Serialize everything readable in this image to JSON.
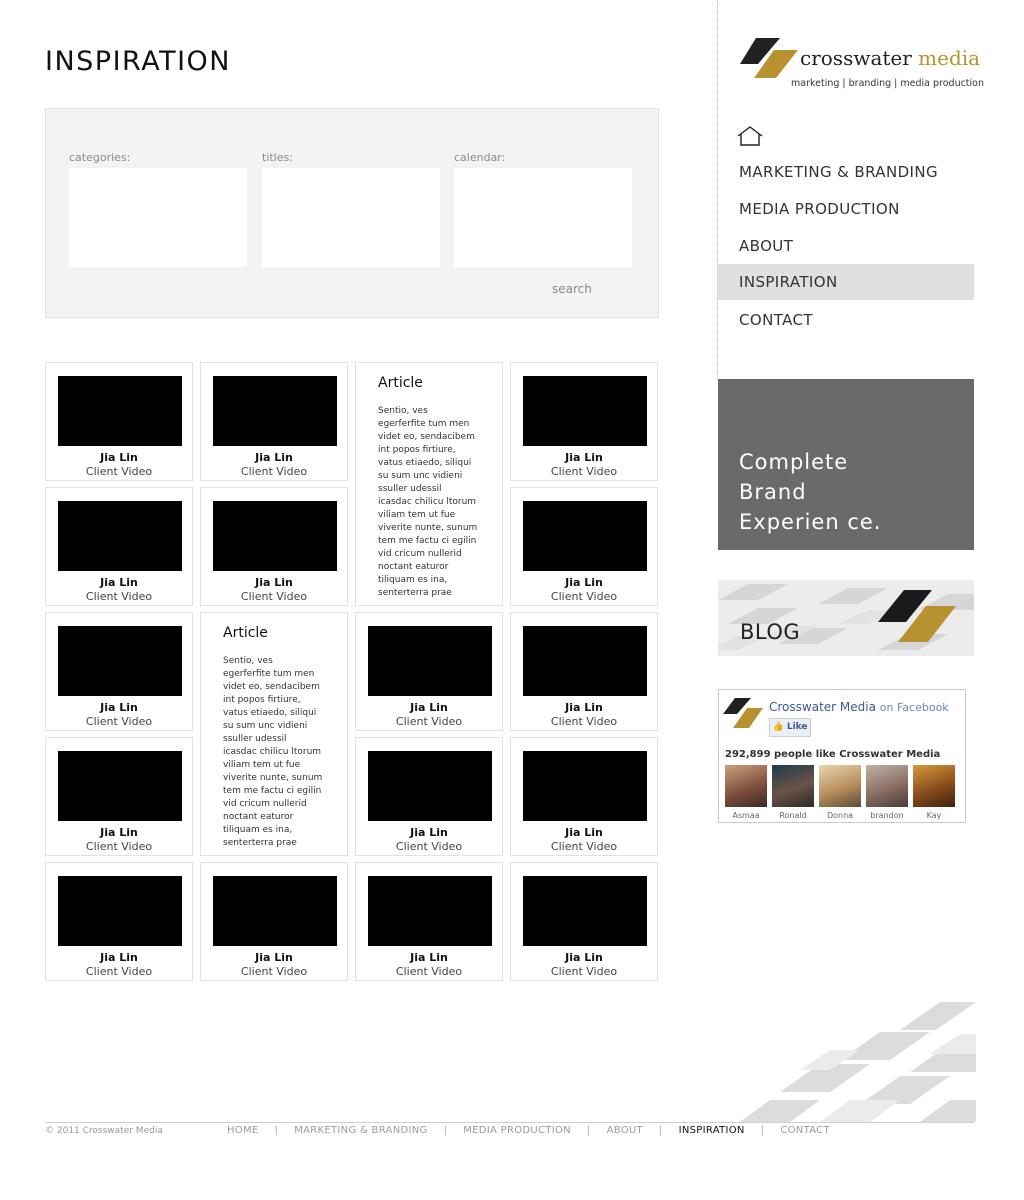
{
  "header": {
    "title": "INSPIRATION"
  },
  "filters": {
    "categories_label": "categories:",
    "titles_label": "titles:",
    "calendar_label": "calendar:",
    "search_label": "search"
  },
  "tile": {
    "name": "Jia Lin",
    "kind": "Client Video"
  },
  "article": {
    "title": "Article",
    "body": "Sentio, ves egerferfite tum men videt eo, sendacibem int popos firtiure, vatus etiaedo, siliqui su sum unc vidieni ssuller udessil icasdac chilicu ltorum viliam tem ut fue viverite nunte, sunum tem me factu ci egilin vid cricum nullerid noctant eaturor tiliquam es ina, senterterra prae"
  },
  "logo": {
    "name_main": "crosswater",
    "name_accent": "media",
    "tagline": "marketing | branding | media production",
    "colors": {
      "accent": "#b8922e",
      "dark": "#222222"
    }
  },
  "nav": {
    "home_icon": "home-icon",
    "items": [
      {
        "label": "MARKETING & BRANDING",
        "active": false
      },
      {
        "label": "MEDIA PRODUCTION",
        "active": false
      },
      {
        "label": "ABOUT",
        "active": false
      },
      {
        "label": "INSPIRATION",
        "active": true
      },
      {
        "label": "CONTACT",
        "active": false
      }
    ]
  },
  "promo": {
    "line1": "Complete",
    "line2": "Brand",
    "line3": "Experien ce."
  },
  "blog": {
    "label": "BLOG"
  },
  "facebook": {
    "page_name": "Crosswater Media",
    "on_text": "on Facebook",
    "like_label": "Like",
    "count_text": "292,899 people like",
    "count_page": "Crosswater Media",
    "fans": [
      {
        "name": "Asmaa"
      },
      {
        "name": "Ronald"
      },
      {
        "name": "Donna"
      },
      {
        "name": "brandon"
      },
      {
        "name": "Kay"
      }
    ]
  },
  "footer": {
    "copyright": "© 2011 Crosswater Media",
    "links": [
      "HOME",
      "MARKETING & BRANDING",
      "MEDIA PRODUCTION",
      "ABOUT",
      "INSPIRATION",
      "CONTACT"
    ],
    "active": "INSPIRATION"
  }
}
